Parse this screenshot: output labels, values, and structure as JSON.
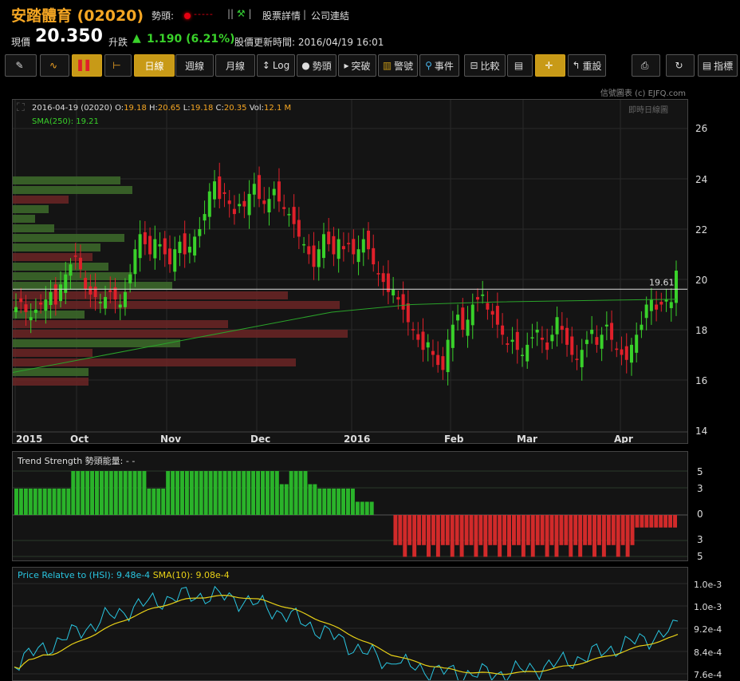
{
  "header": {
    "title": "安踏體育 (02020)",
    "trend_label": "勢頭:",
    "trend_dashes": "-----",
    "icons": "||",
    "link_detail": "股票詳情",
    "link_company": "公司連結",
    "link_sep": "|",
    "price_label": "現價",
    "price_value": "20.350",
    "change_label": "升跌",
    "change_arrow": "▲",
    "change_value": "1.190 (6.21%)",
    "update_label": "股價更新時間: 2016/04/19 16:01"
  },
  "toolbar": {
    "items": [
      {
        "label": "",
        "icon": "✎"
      },
      {
        "label": "",
        "icon": "∿"
      },
      {
        "label": "",
        "icon": "▌▌"
      },
      {
        "label": "",
        "icon": "⊢"
      },
      {
        "label": "日線"
      },
      {
        "label": "週線"
      },
      {
        "label": "月線"
      },
      {
        "label": "Log",
        "icon": "↕"
      },
      {
        "label": "勢頭",
        "icon": "●"
      },
      {
        "label": "突破",
        "icon": "▸"
      },
      {
        "label": "警號",
        "icon": "▥"
      },
      {
        "label": "事件",
        "icon": "⚲"
      },
      {
        "label": "比較",
        "icon": "⊟"
      },
      {
        "label": "",
        "icon": "▤"
      },
      {
        "label": "",
        "icon": "✛"
      },
      {
        "label": "重設",
        "icon": "↰"
      },
      {
        "label": "",
        "icon": "⎙"
      },
      {
        "label": "",
        "icon": "↻"
      },
      {
        "label": "指標",
        "icon": "▤"
      }
    ],
    "active": [
      2,
      4,
      14
    ]
  },
  "credit": "信號圖表 (c) EJFQ.com",
  "main_chart": {
    "corner_right": "即時日線圖",
    "info": {
      "date": "2016-04-19 (02020)",
      "o_label": "O:",
      "o": "19.18",
      "h_label": "H:",
      "h": "20.65",
      "l_label": "L:",
      "l": "19.18",
      "c_label": "C:",
      "c": "20.35",
      "vol_label": "Vol:",
      "vol": "12.1 M"
    },
    "sma_label": "SMA(250): 19.21",
    "ref_label": "19.61",
    "month_labels": [
      "2015",
      "Oct",
      "Nov",
      "Dec",
      "2016",
      "Feb",
      "Mar",
      "Apr"
    ],
    "y_ticks": [
      "26",
      "24",
      "22",
      "20",
      "18",
      "16",
      "14"
    ]
  },
  "trend_panel": {
    "label": "Trend Strength 勢頭能量: - -",
    "y_ticks": [
      "5",
      "3",
      "0",
      "3",
      "5"
    ]
  },
  "rel_panel": {
    "label_a": "Price Relatve to (HSI): 9.48e-4",
    "label_b": "SMA(10): 9.08e-4",
    "y_ticks": [
      "1.0e-3",
      "1.0e-3",
      "9.2e-4",
      "8.4e-4",
      "7.6e-4"
    ]
  },
  "colors": {
    "up": "#39d12a",
    "down": "#e0202a",
    "accent": "#c89a17",
    "sma": "#2aa32a",
    "rel": "#29c5e0",
    "rel_sma": "#e8d016"
  },
  "chart_data": {
    "type": "candlestick",
    "x_start": "2015-09-14",
    "x_end": "2016-04-19",
    "ylim": [
      14,
      26.5
    ],
    "reference_line": 19.61,
    "candles_close": [
      18.9,
      19.1,
      18.7,
      18.5,
      18.8,
      19.0,
      19.2,
      19.5,
      19.0,
      19.8,
      20.2,
      20.6,
      20.9,
      20.4,
      19.6,
      19.4,
      19.3,
      19.1,
      19.3,
      19.5,
      19.2,
      19.0,
      19.5,
      20.2,
      21.2,
      21.8,
      21.4,
      21.0,
      21.6,
      21.4,
      21.0,
      20.6,
      21.2,
      21.5,
      21.0,
      21.3,
      21.7,
      22.0,
      22.6,
      23.5,
      23.9,
      23.2,
      23.4,
      23.0,
      22.6,
      23.0,
      22.9,
      23.4,
      23.8,
      23.2,
      23.0,
      23.2,
      23.6,
      23.1,
      22.8,
      22.6,
      22.2,
      21.7,
      21.4,
      21.0,
      20.5,
      21.2,
      21.8,
      21.4,
      21.0,
      21.6,
      21.2,
      21.4,
      21.0,
      21.2,
      21.6,
      21.2,
      20.6,
      20.2,
      19.9,
      19.5,
      19.6,
      19.2,
      18.8,
      18.3,
      18.0,
      17.6,
      17.2,
      17.5,
      17.0,
      16.6,
      16.4,
      17.6,
      18.2,
      18.6,
      18.0,
      18.4,
      19.0,
      19.2,
      19.4,
      18.8,
      18.6,
      18.2,
      17.8,
      17.4,
      17.6,
      17.2,
      17.0,
      17.4,
      17.7,
      18.0,
      17.6,
      17.2,
      17.8,
      18.5,
      18.0,
      17.4,
      17.0,
      16.8,
      17.2,
      17.6,
      18.0,
      17.4,
      17.8,
      18.2,
      17.6,
      17.2,
      17.0,
      16.8,
      17.4,
      17.8,
      18.2,
      19.0,
      19.2,
      18.8,
      19.0,
      19.2,
      19.1,
      20.35
    ],
    "sma250": [
      [
        0,
        16.3
      ],
      [
        100,
        16.9
      ],
      [
        200,
        17.5
      ],
      [
        300,
        18.1
      ],
      [
        400,
        18.7
      ],
      [
        500,
        19.0
      ],
      [
        600,
        19.1
      ],
      [
        700,
        19.15
      ],
      [
        800,
        19.2
      ],
      [
        832,
        19.21
      ]
    ],
    "trend_strength_note": "positive bars Sep–Jan, negative Jan–Apr",
    "rel_value": "9.48e-4",
    "rel_sma": "9.08e-4"
  }
}
